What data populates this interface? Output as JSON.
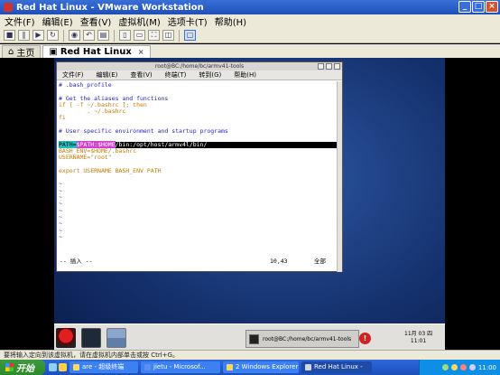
{
  "vmware": {
    "title": "Red Hat Linux - VMware Workstation",
    "window_buttons": [
      "_",
      "□",
      "×"
    ],
    "menu": [
      "文件(F)",
      "编辑(E)",
      "查看(V)",
      "虚拟机(M)",
      "选项卡(T)",
      "帮助(H)"
    ],
    "tabs": [
      {
        "label": "主页",
        "icon": "home-icon"
      },
      {
        "label": "Red Hat Linux",
        "icon": "vm-icon",
        "close": "×"
      }
    ],
    "status_text": "要将输入定向到该虚拟机，请在虚拟机内部单击或按 Ctrl+G。"
  },
  "terminal": {
    "title": "root@BC:/home/bc/armv41-tools",
    "menu": [
      "文件(F)",
      "编辑(E)",
      "查看(V)",
      "终端(T)",
      "转到(G)",
      "帮助(H)"
    ],
    "lines": [
      "# .bash_profile",
      "",
      "# Get the aliases and functions",
      "if [ -f ~/.bashrc ]; then",
      "        . ~/.bashrc",
      "fi",
      "",
      "# User specific environment and startup programs",
      "",
      "PATH=$PATH:$HOME/bin:/opt/host/armv4l/bin/",
      "BASH_ENV=$HOME/.bashrc",
      "USERNAME=\"root\"",
      "",
      "export USERNAME BASH_ENV PATH",
      "",
      "~",
      "~",
      "~",
      "~",
      "~",
      "~",
      "~",
      "~",
      "~"
    ],
    "highlight": {
      "prefix_cyan": "PATH=",
      "middle_mag": "$PATH:",
      "rest_mag": "$HOME",
      "rest_plain": "/bin:/opt/host/armv4l/bin/"
    },
    "status": {
      "mode": "-- 插入 --",
      "position": "10,43",
      "percent": "全部"
    }
  },
  "guest_panel": {
    "task_label": "root@BC:/home/bc/armv41-tools",
    "date": "11月 03 四",
    "time": "11:01"
  },
  "taskbar": {
    "start_label": "开始",
    "buttons": [
      {
        "label": "are - 超级终端",
        "active": false
      },
      {
        "label": "jietu - Microsof...",
        "active": false
      },
      {
        "label": "2 Windows Explorer",
        "active": false
      },
      {
        "label": "Red Hat Linux -",
        "active": true
      }
    ],
    "clock": "11:00"
  },
  "colors": {
    "xp_blue": "#245bd0",
    "start_green": "#2d8a2d",
    "guest_desktop": "#14306c"
  }
}
